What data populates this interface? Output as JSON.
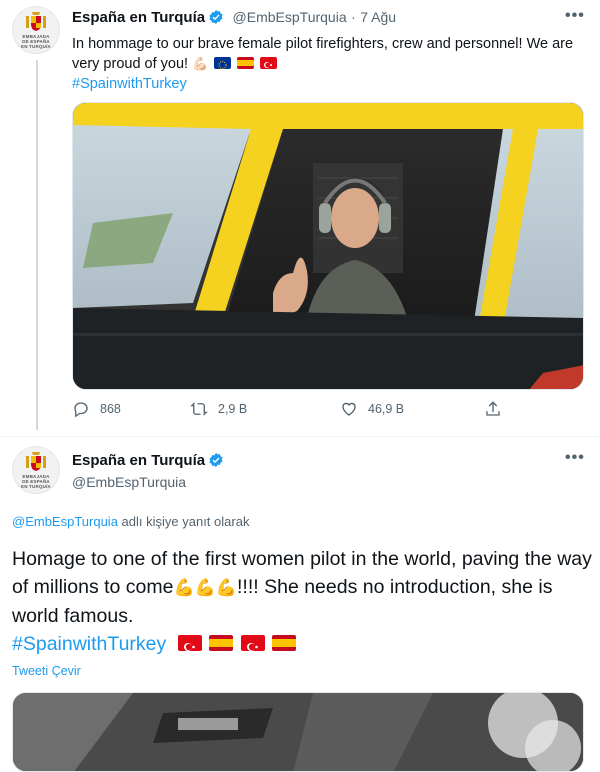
{
  "tweet1": {
    "display_name": "España en Turquía",
    "handle": "@EmbEspTurquia",
    "separator": "·",
    "date": "7 Ağu",
    "text": "In hommage to our brave female pilot firefighters, crew and personnel! We are very proud of you!",
    "emoji": "💪🏻",
    "hashtag": "#SpainwithTurkey",
    "stats": {
      "replies": "868",
      "retweets": "2,9 B",
      "likes": "46,9 B"
    },
    "more": "•••"
  },
  "avatar_motto": [
    "EMBAJADA",
    "DE ESPAÑA",
    "EN TURQUÍA"
  ],
  "tweet2": {
    "display_name": "España en Turquía",
    "handle": "@EmbEspTurquia",
    "more": "•••",
    "reply_mention": "@EmbEspTurquia",
    "reply_suffix": " adlı kişiye yanıt olarak",
    "text_part1": "Homage to one of the first women pilot in the world, paving the way of millions to come",
    "emojis": "💪💪💪",
    "text_part2": "!!!! She needs no introduction, she is world famous.",
    "hashtag": "#SpainwithTurkey",
    "translate": "Tweeti Çevir"
  },
  "colors": {
    "link": "#1d9bf0",
    "verified": "#1d9bf0",
    "muted": "#536471",
    "plane_yellow": "#f4d21f"
  },
  "icons": [
    "verified-badge-icon",
    "reply-icon",
    "retweet-icon",
    "like-icon",
    "share-icon",
    "more-icon"
  ]
}
